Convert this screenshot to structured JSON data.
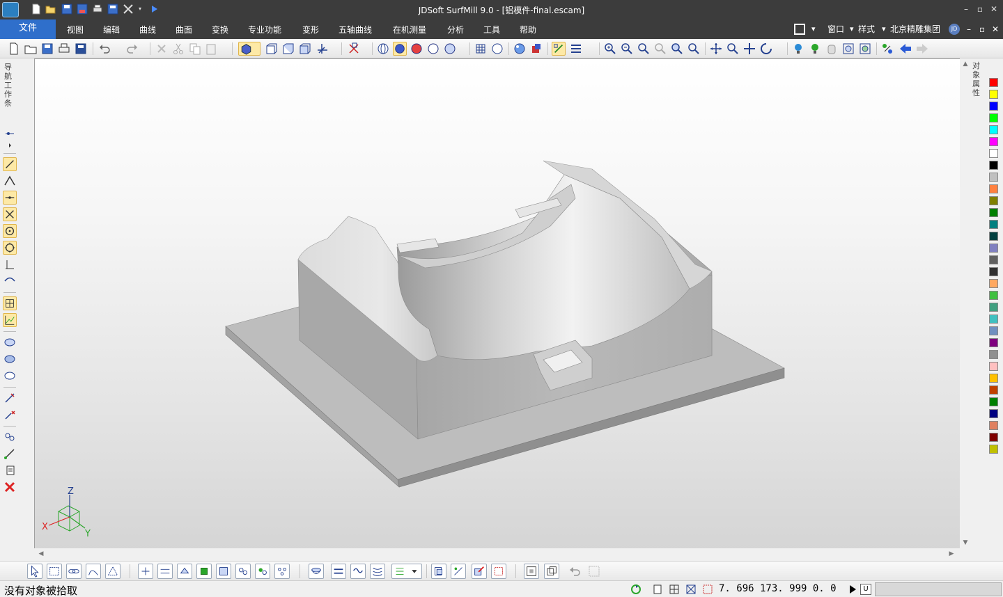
{
  "app": {
    "title": "JDSoft SurfMill 9.0 - [铝模件-final.escam]"
  },
  "menu": {
    "file": "文件",
    "items": [
      "视图",
      "编辑",
      "曲线",
      "曲面",
      "变换",
      "专业功能",
      "变形",
      "五轴曲线",
      "在机测量",
      "分析",
      "工具",
      "帮助"
    ],
    "window": "窗口",
    "style": "样式",
    "company": "北京精雕集团",
    "user_badge": "JD"
  },
  "nav_tab_label": "导航工作条",
  "right_tab_label": "对象属性",
  "axis_labels": {
    "x": "X",
    "y": "Y",
    "z": "Z"
  },
  "palette": [
    "#ff0000",
    "#ffff00",
    "#0000ff",
    "#00ff00",
    "#00ffff",
    "#ff00ff",
    "#ffffff",
    "#000000",
    "#c0c0c0",
    "#ff8040",
    "#808000",
    "#008000",
    "#008080",
    "#004040",
    "#8080c0",
    "#606060",
    "#303030",
    "#ffa860",
    "#40c040",
    "#40a080",
    "#40c0c0",
    "#7090c0",
    "#800080",
    "#909090",
    "#ffc0c0",
    "#ffc000",
    "#c04000",
    "#008000",
    "#000080",
    "#e08060",
    "#800000",
    "#c0c000"
  ],
  "status": {
    "message": "没有对象被拾取",
    "coords": "7. 696  173. 999  0. 0",
    "unit_box": "U"
  },
  "icons": {
    "quick_access": [
      "new-file-icon",
      "open-file-icon",
      "save-icon",
      "save-as-icon",
      "print-icon",
      "save-all-icon",
      "tools-icon"
    ],
    "toolbar": [
      "new-icon",
      "open-icon",
      "save-icon",
      "print-icon",
      "save-copy-icon",
      "undo-icon",
      "redo-icon",
      "delete-icon",
      "cut-icon",
      "copy-icon",
      "paste-icon",
      "shaded-view-icon",
      "view-front-icon",
      "view-top-icon",
      "view-iso-icon",
      "view-axis-icon",
      "select-filter-icon",
      "render-wire-icon",
      "render-shade-icon",
      "render-color-icon",
      "render-outline-icon",
      "render-mode-icon",
      "mesh-icon",
      "sphere-icon",
      "light-icon",
      "material-icon",
      "snap-icon",
      "layer-icon",
      "zoom-in-icon",
      "zoom-out-icon",
      "zoom-window-icon",
      "zoom-prev-icon",
      "zoom-all-icon",
      "zoom-fit-icon",
      "pan-icon",
      "zoom-dynamic-icon",
      "move-icon",
      "rotate-icon",
      "lightbulb-icon",
      "lightbulb-green-icon",
      "hand-icon",
      "display-icon",
      "hide-icon",
      "arrange-icon",
      "back-arrow-icon",
      "forward-arrow-icon"
    ]
  }
}
